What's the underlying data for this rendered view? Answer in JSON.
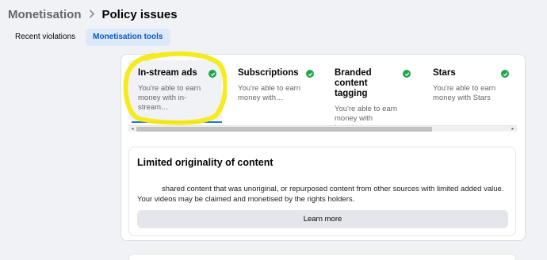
{
  "breadcrumb": {
    "parent": "Monetisation",
    "separator": ">",
    "current": "Policy issues"
  },
  "tabs": [
    {
      "label": "Recent violations",
      "active": false
    },
    {
      "label": "Monetisation tools",
      "active": true
    }
  ],
  "tools": [
    {
      "title": "In-stream ads",
      "description": "You're able to earn money with in-stream…",
      "status": "check-circle-icon",
      "selected": true
    },
    {
      "title": "Subscriptions",
      "description": "You're able to earn money with…",
      "status": "check-circle-icon",
      "selected": false
    },
    {
      "title": "Branded content tagging",
      "description": "You're able to earn money with branded…",
      "status": "check-circle-icon",
      "selected": false
    },
    {
      "title": "Stars",
      "description": "You're able to earn money with Stars",
      "status": "check-circle-icon",
      "selected": false
    }
  ],
  "notice": {
    "title": "Limited originality of content",
    "body_line1": "shared content that was unoriginal, or repurposed content from other sources with limited added value.",
    "body_line2": "Your videos may be claimed and monetised by the rights holders.",
    "button_label": "Learn more"
  },
  "colors": {
    "accent": "#1877f2",
    "success": "#21a64a",
    "highlight": "#f5ea14",
    "active_tab_bg": "#dde8f8"
  }
}
